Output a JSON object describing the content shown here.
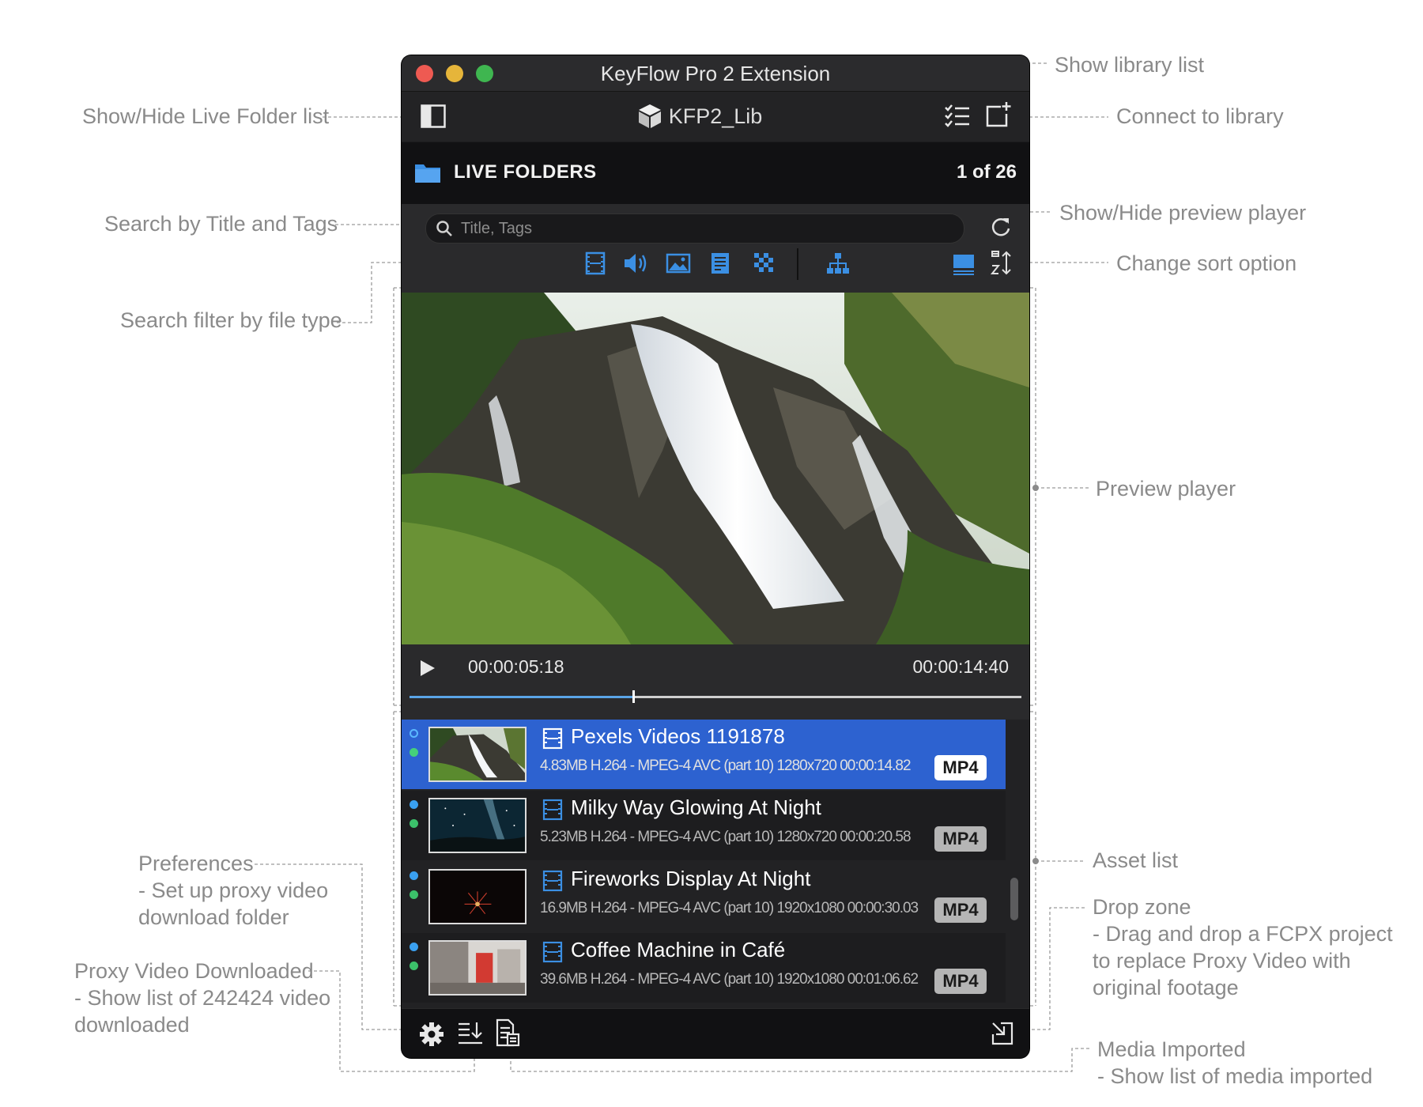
{
  "annotations": {
    "show_hide_folder_list": "Show/Hide Live Folder list",
    "search_title_tags": "Search by Title and Tags",
    "search_filter_type": "Search filter by file type",
    "preferences": "Preferences\n- Set up proxy video\n  download folder",
    "proxy_downloaded": "Proxy Video Downloaded\n- Show list of 242424 video\n  downloaded",
    "show_library_list": "Show library list",
    "connect_library": "Connect to library",
    "show_hide_preview": "Show/Hide preview player",
    "change_sort": "Change sort option",
    "preview_player": "Preview player",
    "asset_list": "Asset list",
    "drop_zone": "Drop zone\n- Drag and drop a FCPX project\n  to replace Proxy Video with\n  original footage",
    "media_imported": "Media Imported\n- Show list of media imported"
  },
  "window": {
    "title": "KeyFlow Pro 2 Extension",
    "library_name": "KFP2_Lib"
  },
  "folders": {
    "title": "LIVE FOLDERS",
    "count": "1 of 26"
  },
  "search": {
    "placeholder": "Title, Tags",
    "value": ""
  },
  "player": {
    "current_time": "00:00:05:18",
    "duration": "00:00:14:40",
    "progress": 0.365
  },
  "assets": [
    {
      "title": "Pexels Videos 1191878",
      "meta": "4.83MB H.264 - MPEG-4 AVC (part 10) 1280x720 00:00:14.82",
      "format": "MP4",
      "selected": true
    },
    {
      "title": "Milky Way Glowing At Night",
      "meta": "5.23MB H.264 - MPEG-4 AVC (part 10) 1280x720 00:00:20.58",
      "format": "MP4",
      "selected": false
    },
    {
      "title": "Fireworks Display At Night",
      "meta": "16.9MB H.264 - MPEG-4 AVC (part 10) 1920x1080 00:00:30.03",
      "format": "MP4",
      "selected": false
    },
    {
      "title": "Coffee Machine in Café",
      "meta": "39.6MB H.264 - MPEG-4 AVC (part 10) 1920x1080 00:01:06.62",
      "format": "MP4",
      "selected": false
    }
  ],
  "icons": {
    "sidebar": "sidebar-toggle-icon",
    "library": "cube-icon",
    "library_list": "list-icon",
    "connect": "add-library-icon",
    "folder": "folder-icon",
    "search": "search-icon",
    "refresh": "refresh-icon",
    "filters": [
      "video-filter-icon",
      "audio-filter-icon",
      "image-filter-icon",
      "document-filter-icon",
      "pattern-filter-icon",
      "hierarchy-filter-icon"
    ],
    "preview_toggle": "preview-toggle-icon",
    "sort": "sort-icon",
    "play": "play-icon",
    "preferences": "gear-icon",
    "proxy": "download-list-icon",
    "media_imported": "document-list-icon",
    "drop_zone": "drop-zone-icon"
  },
  "colors": {
    "accent": "#2d62d0",
    "icon_blue": "#3b8fe3",
    "status_blue": "#3aa0f0",
    "status_green": "#3cc06a"
  }
}
